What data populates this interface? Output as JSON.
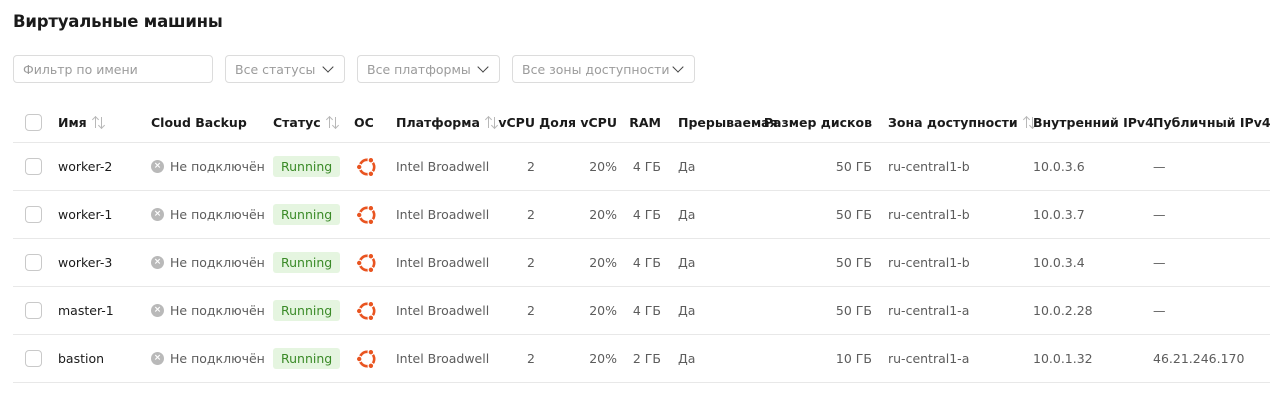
{
  "page_title": "Виртуальные машины",
  "filters": {
    "name_placeholder": "Фильтр по имени",
    "status": "Все статусы",
    "platform": "Все платформы",
    "zone": "Все зоны доступности"
  },
  "columns": {
    "name": "Имя",
    "backup": "Cloud Backup",
    "status": "Статус",
    "os": "ОС",
    "platform": "Платформа",
    "vcpu": "vCPU",
    "vcpu_share": "Доля vCPU",
    "ram": "RAM",
    "preemptible": "Прерываемая",
    "disk": "Размер дисков",
    "zone": "Зона доступности",
    "ipv4_internal": "Внутренний IPv4",
    "ipv4_public": "Публичный IPv4"
  },
  "os_icon": "ubuntu-icon",
  "colors": {
    "running_bg": "#e5f5e0",
    "running_text": "#3a8a27",
    "ubuntu": "#e95420"
  },
  "rows": [
    {
      "name": "worker-2",
      "backup": "Не подключён",
      "status": "Running",
      "platform": "Intel Broadwell",
      "vcpu": "2",
      "vcpu_share": "20%",
      "ram": "4 ГБ",
      "preemptible": "Да",
      "disk": "50 ГБ",
      "zone": "ru-central1-b",
      "ipv4_internal": "10.0.3.6",
      "ipv4_public": "—"
    },
    {
      "name": "worker-1",
      "backup": "Не подключён",
      "status": "Running",
      "platform": "Intel Broadwell",
      "vcpu": "2",
      "vcpu_share": "20%",
      "ram": "4 ГБ",
      "preemptible": "Да",
      "disk": "50 ГБ",
      "zone": "ru-central1-b",
      "ipv4_internal": "10.0.3.7",
      "ipv4_public": "—"
    },
    {
      "name": "worker-3",
      "backup": "Не подключён",
      "status": "Running",
      "platform": "Intel Broadwell",
      "vcpu": "2",
      "vcpu_share": "20%",
      "ram": "4 ГБ",
      "preemptible": "Да",
      "disk": "50 ГБ",
      "zone": "ru-central1-b",
      "ipv4_internal": "10.0.3.4",
      "ipv4_public": "—"
    },
    {
      "name": "master-1",
      "backup": "Не подключён",
      "status": "Running",
      "platform": "Intel Broadwell",
      "vcpu": "2",
      "vcpu_share": "20%",
      "ram": "4 ГБ",
      "preemptible": "Да",
      "disk": "50 ГБ",
      "zone": "ru-central1-a",
      "ipv4_internal": "10.0.2.28",
      "ipv4_public": "—"
    },
    {
      "name": "bastion",
      "backup": "Не подключён",
      "status": "Running",
      "platform": "Intel Broadwell",
      "vcpu": "2",
      "vcpu_share": "20%",
      "ram": "2 ГБ",
      "preemptible": "Да",
      "disk": "10 ГБ",
      "zone": "ru-central1-a",
      "ipv4_internal": "10.0.1.32",
      "ipv4_public": "46.21.246.170"
    }
  ]
}
